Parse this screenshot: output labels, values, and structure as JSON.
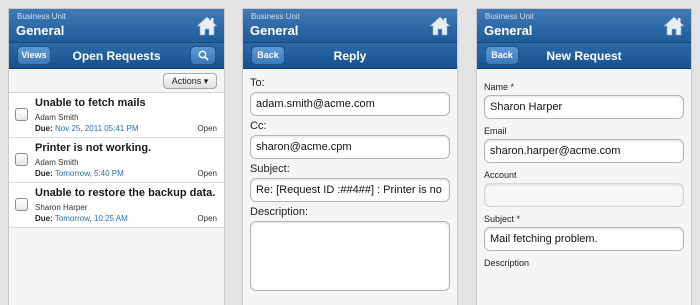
{
  "header": {
    "business_unit_label": "Business Unit",
    "business_unit_value": "General",
    "home_icon": "home-icon"
  },
  "panel1": {
    "views_label": "Views",
    "title": "Open Requests",
    "search_icon": "search-icon",
    "actions_label": "Actions ▾",
    "requests": [
      {
        "title": "Unable to fetch mails",
        "requester": "Adam Smith",
        "due_label": "Due:",
        "due": "Nov 25, 2011 05:41 PM",
        "status": "Open"
      },
      {
        "title": "Printer is not working.",
        "requester": "Adam Smith",
        "due_label": "Due:",
        "due": "Tomorrow, 5:40 PM",
        "status": "Open"
      },
      {
        "title": "Unable to restore the backup data.",
        "requester": "Sharon Harper",
        "due_label": "Due:",
        "due": "Tomorrow, 10:25 AM",
        "status": "Open"
      }
    ]
  },
  "panel2": {
    "back_label": "Back",
    "title": "Reply",
    "to_label": "To:",
    "to_value": "adam.smith@acme.com",
    "cc_label": "Cc:",
    "cc_value": "sharon@acme.cpm",
    "subject_label": "Subject:",
    "subject_value": "Re: [Request ID :##4##] : Printer is no",
    "description_label": "Description:"
  },
  "panel3": {
    "back_label": "Back",
    "title": "New Request",
    "name_label": "Name *",
    "name_value": "Sharon Harper",
    "email_label": "Email",
    "email_value": "sharon.harper@acme.com",
    "account_label": "Account",
    "account_value": "",
    "subject_label": "Subject *",
    "subject_value": "Mail fetching problem.",
    "description_label": "Description"
  },
  "colors": {
    "header_blue": "#1f5c99",
    "link_blue": "#2a6fb6"
  }
}
